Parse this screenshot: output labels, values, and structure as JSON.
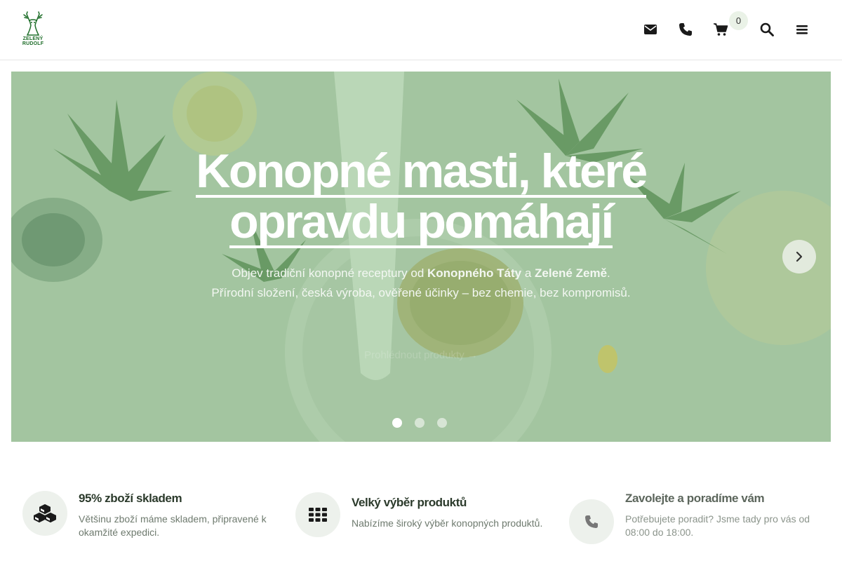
{
  "header": {
    "logo": {
      "line1": "ZELENÝ",
      "line2": "RUDOLF"
    },
    "icons": [
      "envelope-icon",
      "phone-icon",
      "cart-icon",
      "search-icon",
      "menu-icon"
    ],
    "cart_count": "0"
  },
  "hero": {
    "title_line1": "Konopné masti, které",
    "title_line2": "opravdu pomáhají",
    "subtitle1_a": "Objev tradiční konopné receptury od ",
    "subtitle1_b": "Konopného Táty",
    "subtitle1_c": " a ",
    "subtitle1_d": "Zelené Země",
    "subtitle1_e": ".",
    "subtitle2": "Přírodní složení, česká výroba, ověřené účinky – bez chemie, bez kompromisů.",
    "cta": "Prohlédnout produkty →",
    "slides": 3,
    "active_slide": 1
  },
  "features": [
    {
      "icon": "cubes-icon",
      "title": "95% zboží skladem",
      "desc": "Většinu zboží máme skladem, připravené k okamžité expedici."
    },
    {
      "icon": "grid-icon",
      "title": "Velký výběr produktů",
      "desc": "Nabízíme široký výběr konopných produktů."
    },
    {
      "icon": "phone-icon",
      "title": "Zavolejte a poradíme vám",
      "desc": "Potřebujete poradit? Jsme tady pro vás od 08:00 do 18:00."
    }
  ],
  "colors": {
    "brand_green": "#1f6e2a",
    "hero_tint": "#a9c9a8",
    "feature_circle": "#edf1ec"
  }
}
